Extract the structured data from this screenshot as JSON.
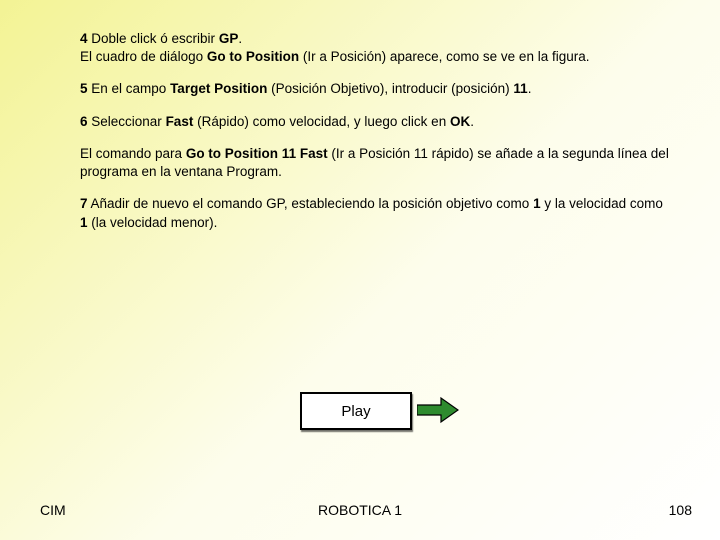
{
  "body": {
    "p1_num": "4",
    "p1_a": " Doble click ó escribir ",
    "p1_gp": "GP",
    "p1_b": ".",
    "p1_line2a": "El cuadro de diálogo ",
    "p1_gotopos": "Go to Position",
    "p1_line2b": " (Ir a Posición) aparece, como se ve en la figura.",
    "p2_num": "5",
    "p2_a": " En el campo ",
    "p2_tp": "Target Position",
    "p2_b": " (Posición Objetivo), introducir (posición) ",
    "p2_11": "11",
    "p2_c": ".",
    "p3_num": "6",
    "p3_a": " Seleccionar ",
    "p3_fast": "Fast",
    "p3_b": " (Rápido) como velocidad, y luego click en ",
    "p3_ok": "OK",
    "p3_c": ".",
    "p4_a": "El comando para ",
    "p4_cmd": "Go to Position 11 Fast",
    "p4_b": " (Ir a Posición 11 rápido) se añade a la segunda línea del programa en la ventana Program.",
    "p5_num": "7",
    "p5_a": " Añadir de nuevo el comando GP, estableciendo la posición objetivo como ",
    "p5_one1": "1",
    "p5_b": " y la velocidad como ",
    "p5_one2": "1",
    "p5_c": " (la velocidad menor)."
  },
  "play_label": "Play",
  "footer": {
    "left": "CIM",
    "center": "ROBOTICA 1",
    "right": "108"
  }
}
